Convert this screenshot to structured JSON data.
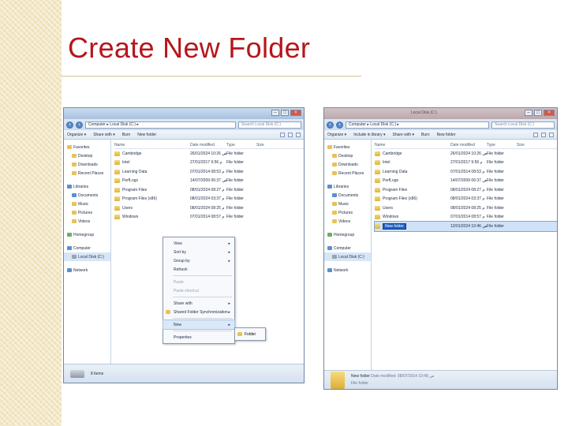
{
  "slide": {
    "title": "Create New Folder"
  },
  "window1": {
    "address": "Computer ▸ Local Disk (C:) ▸",
    "search_placeholder": "Search Local Disk (C:)",
    "commands": [
      "Organize ▾",
      "Share with ▾",
      "Burn",
      "New folder"
    ],
    "nav": [
      {
        "label": "Favorites",
        "icon": "star-icon",
        "child": false,
        "gap": false
      },
      {
        "label": "Desktop",
        "icon": "desktop-icon",
        "child": true,
        "gap": false
      },
      {
        "label": "Downloads",
        "icon": "downloads-icon",
        "child": true,
        "gap": false
      },
      {
        "label": "Recent Places",
        "icon": "recent-places-icon",
        "child": true,
        "gap": false
      },
      {
        "label": "Libraries",
        "icon": "libraries-icon",
        "child": false,
        "gap": true
      },
      {
        "label": "Documents",
        "icon": "documents-icon",
        "child": true,
        "gap": false
      },
      {
        "label": "Music",
        "icon": "music-icon",
        "child": true,
        "gap": false
      },
      {
        "label": "Pictures",
        "icon": "pictures-icon",
        "child": true,
        "gap": false
      },
      {
        "label": "Videos",
        "icon": "videos-icon",
        "child": true,
        "gap": false
      },
      {
        "label": "Homegroup",
        "icon": "homegroup-icon",
        "child": false,
        "gap": true
      },
      {
        "label": "Computer",
        "icon": "computer-icon",
        "child": false,
        "gap": true
      },
      {
        "label": "Local Disk (C:)",
        "icon": "drive-icon",
        "child": true,
        "gap": false,
        "selected": true
      },
      {
        "label": "Network",
        "icon": "network-icon",
        "child": false,
        "gap": true
      }
    ],
    "columns": {
      "name": "Name",
      "date": "Date modified",
      "type": "Type",
      "size": "Size"
    },
    "files": [
      {
        "name": "Cambridge",
        "date": "26/01/2024 10:26 ص",
        "type": "File folder"
      },
      {
        "name": "Intel",
        "date": "27/01/2017 9:56 م",
        "type": "File folder"
      },
      {
        "name": "Learning Data",
        "date": "07/01/2014 08:53 م",
        "type": "File folder"
      },
      {
        "name": "PerfLogs",
        "date": "14/07/2009 06:37 ص",
        "type": "File folder"
      },
      {
        "name": "Program Files",
        "date": "08/01/2024 08:27 م",
        "type": "File folder"
      },
      {
        "name": "Program Files (x86)",
        "date": "08/01/2024 03:37 م",
        "type": "File folder"
      },
      {
        "name": "Users",
        "date": "08/01/2024 08:25 م",
        "type": "File folder"
      },
      {
        "name": "Windows",
        "date": "07/01/2014 08:57 م",
        "type": "File folder"
      }
    ],
    "status": "8 items"
  },
  "context_menu": {
    "items": [
      {
        "label": "View",
        "arrow": true
      },
      {
        "label": "Sort by",
        "arrow": true
      },
      {
        "label": "Group by",
        "arrow": true
      },
      {
        "label": "Refresh",
        "arrow": false
      },
      {
        "sep": true
      },
      {
        "label": "Paste",
        "arrow": false,
        "disabled": true
      },
      {
        "label": "Paste shortcut",
        "arrow": false,
        "disabled": true
      },
      {
        "sep": true
      },
      {
        "label": "Share with",
        "arrow": true
      },
      {
        "label": "Shared Folder Synchronization",
        "arrow": true,
        "icon": true
      },
      {
        "sep": true
      },
      {
        "label": "New",
        "arrow": true,
        "active": true
      },
      {
        "sep": true
      },
      {
        "label": "Properties",
        "arrow": false
      }
    ],
    "submenu": [
      "Folder"
    ]
  },
  "window2": {
    "title": "Local Disk (C:)",
    "address": "Computer ▸ Local Disk (C:) ▸",
    "search_placeholder": "Search Local Disk (C:)",
    "commands": [
      "Organize ▾",
      "Include in library ▾",
      "Share with ▾",
      "Burn",
      "New folder"
    ],
    "nav": [
      {
        "label": "Favorites",
        "icon": "star-icon",
        "child": false,
        "gap": false
      },
      {
        "label": "Desktop",
        "icon": "desktop-icon",
        "child": true,
        "gap": false
      },
      {
        "label": "Downloads",
        "icon": "downloads-icon",
        "child": true,
        "gap": false
      },
      {
        "label": "Recent Places",
        "icon": "recent-places-icon",
        "child": true,
        "gap": false
      },
      {
        "label": "Libraries",
        "icon": "libraries-icon",
        "child": false,
        "gap": true
      },
      {
        "label": "Documents",
        "icon": "documents-icon",
        "child": true,
        "gap": false
      },
      {
        "label": "Music",
        "icon": "music-icon",
        "child": true,
        "gap": false
      },
      {
        "label": "Pictures",
        "icon": "pictures-icon",
        "child": true,
        "gap": false
      },
      {
        "label": "Videos",
        "icon": "videos-icon",
        "child": true,
        "gap": false
      },
      {
        "label": "Homegroup",
        "icon": "homegroup-icon",
        "child": false,
        "gap": true
      },
      {
        "label": "Computer",
        "icon": "computer-icon",
        "child": false,
        "gap": true
      },
      {
        "label": "Local Disk (C:)",
        "icon": "drive-icon",
        "child": true,
        "gap": false,
        "selected": true
      },
      {
        "label": "Network",
        "icon": "network-icon",
        "child": false,
        "gap": true
      }
    ],
    "columns": {
      "name": "Name",
      "date": "Date modified",
      "type": "Type",
      "size": "Size"
    },
    "files": [
      {
        "name": "Cambridge",
        "date": "26/01/2024 10:26 ص",
        "type": "File folder"
      },
      {
        "name": "Intel",
        "date": "27/01/2017 9:56 م",
        "type": "File folder"
      },
      {
        "name": "Learning Data",
        "date": "07/01/2014 08:53 م",
        "type": "File folder"
      },
      {
        "name": "PerfLogs",
        "date": "14/07/2009 06:37 ص",
        "type": "File folder"
      },
      {
        "name": "Program Files",
        "date": "08/01/2024 08:27 م",
        "type": "File folder"
      },
      {
        "name": "Program Files (x86)",
        "date": "08/01/2024 03:37 م",
        "type": "File folder"
      },
      {
        "name": "Users",
        "date": "08/01/2024 08:25 م",
        "type": "File folder"
      },
      {
        "name": "Windows",
        "date": "07/01/2014 08:57 م",
        "type": "File folder"
      },
      {
        "name": "New folder",
        "date": "12/01/2024 10:46 ص",
        "type": "File folder",
        "highlight": true
      }
    ],
    "status_name": "New folder",
    "status_date": "Date modified: 08/07/2014 10:48 ص",
    "status_type": "File folder"
  }
}
